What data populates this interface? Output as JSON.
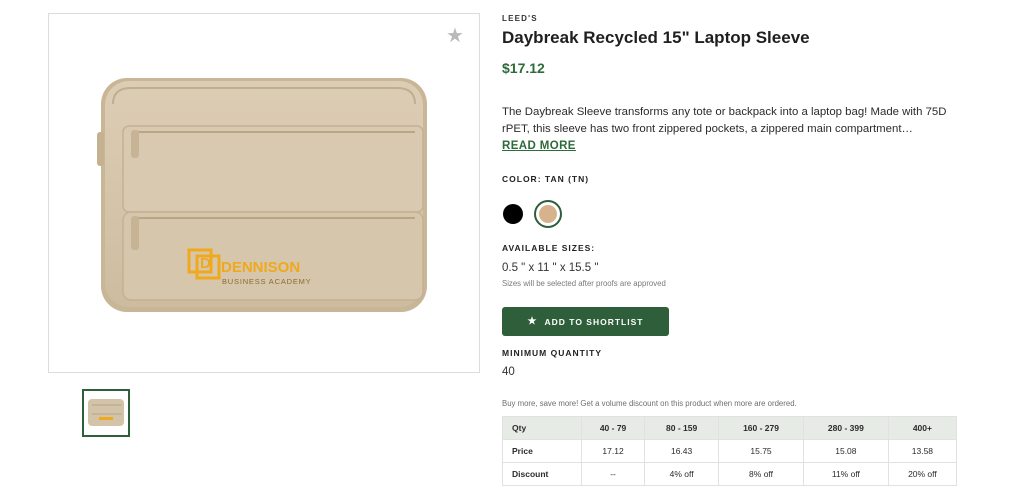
{
  "product": {
    "brand": "LEED'S",
    "title": "Daybreak Recycled 15\" Laptop Sleeve",
    "price": "$17.12",
    "description": "The Daybreak Sleeve transforms any tote or backpack into a laptop bag! Made with 75D rPET, this sleeve has two front zippered pockets, a zippered main compartment…",
    "read_more": "READ MORE",
    "imprint": {
      "logo_name": "DENNISON",
      "logo_sub": "BUSINESS ACADEMY",
      "logo_letter": "D"
    }
  },
  "color": {
    "label": "COLOR: TAN (TN)",
    "swatches": [
      {
        "name": "Black",
        "hex": "#000000",
        "selected": false
      },
      {
        "name": "Tan",
        "hex": "#d6b38c",
        "selected": true
      }
    ]
  },
  "sizes": {
    "label": "AVAILABLE SIZES:",
    "value": "0.5 \" x 11 \" x 15.5 \"",
    "note": "Sizes will be selected after proofs are approved"
  },
  "shortlist_button": {
    "label": "ADD TO SHORTLIST",
    "icon": "star-icon"
  },
  "min_quantity": {
    "label": "MINIMUM QUANTITY",
    "value": "40"
  },
  "pricing": {
    "promo": "Buy more, save more! Get a volume discount on this product when more are ordered.",
    "row_labels": [
      "Qty",
      "Price",
      "Discount"
    ],
    "qty": [
      "40 - 79",
      "80 - 159",
      "160 - 279",
      "280 - 399",
      "400+"
    ],
    "price": [
      "17.12",
      "16.43",
      "15.75",
      "15.08",
      "13.58"
    ],
    "discount": [
      "--",
      "4% off",
      "8% off",
      "11% off",
      "20% off"
    ]
  },
  "colors": {
    "accent_green": "#2e5e3a",
    "price_green": "#2e6b3a",
    "product_tan": "#d6c7ae",
    "logo_orange": "#f0a81c"
  }
}
